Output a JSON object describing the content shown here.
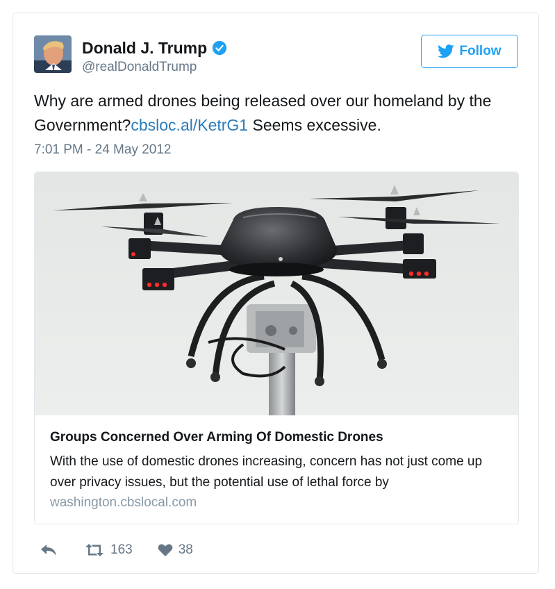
{
  "author": {
    "name": "Donald J. Trump",
    "handle": "@realDonaldTrump",
    "avatar_icon": "avatar-portrait",
    "verified_icon": "verified-badge-icon"
  },
  "follow_button": {
    "label": "Follow",
    "icon": "twitter-bird-icon"
  },
  "tweet": {
    "text_before": "Why are armed drones being released over our homeland by the Government?",
    "link_text": "cbsloc.al/KetrG1",
    "text_after": " Seems excessive.",
    "timestamp": "7:01 PM - 24 May 2012"
  },
  "card": {
    "image_icon": "drone-photo",
    "title": "Groups Concerned Over Arming Of Domestic Drones",
    "description": "With the use of domestic drones increasing, concern has not just come up over privacy issues, but the potential use of lethal force by",
    "domain": "washington.cbslocal.com"
  },
  "actions": {
    "reply_icon": "reply-icon",
    "retweet_icon": "retweet-icon",
    "retweet_count": "163",
    "like_icon": "heart-icon",
    "like_count": "38"
  },
  "colors": {
    "accent": "#1da1f2",
    "link": "#2b7bb9",
    "text": "#14171a",
    "secondary": "#657786",
    "border": "#e1e8ed"
  }
}
